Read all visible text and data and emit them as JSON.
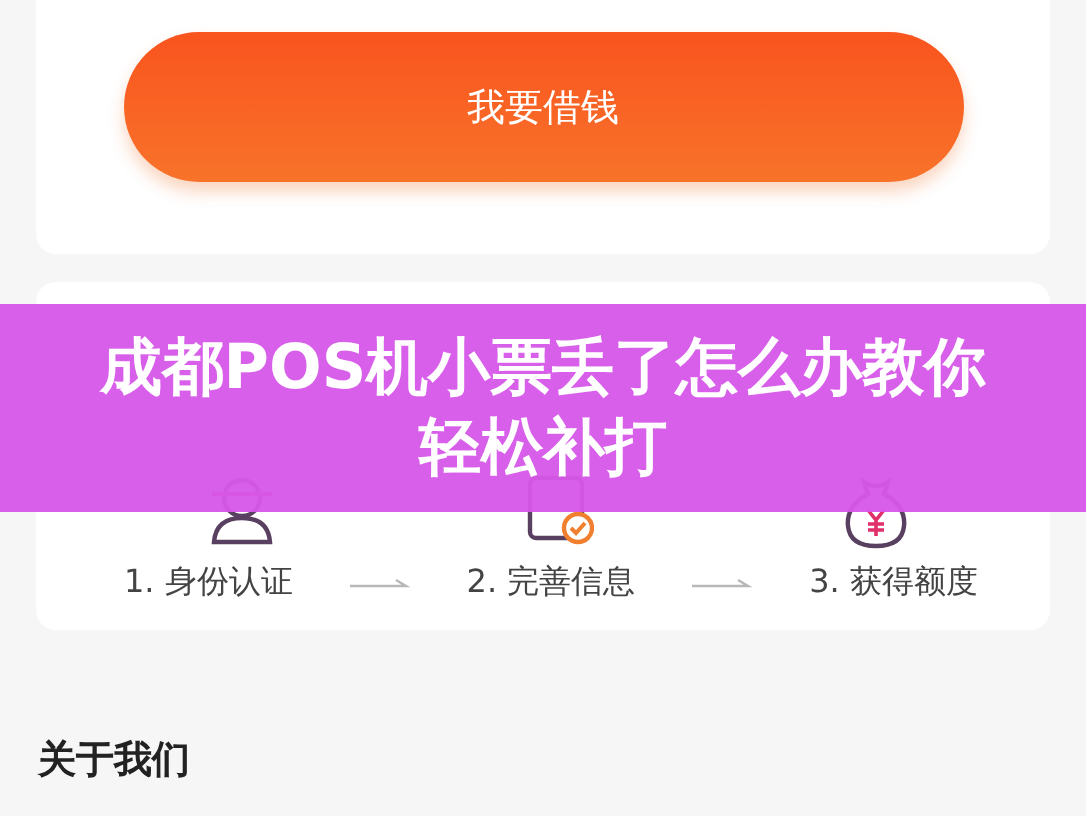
{
  "loan_button": {
    "label": "我要借钱"
  },
  "steps": [
    {
      "label": "1. 身份认证",
      "kind": "identity"
    },
    {
      "label": "2. 完善信息",
      "kind": "info"
    },
    {
      "label": "3. 获得额度",
      "kind": "credit"
    }
  ],
  "about": {
    "title": "关于我们"
  },
  "banner": {
    "title": "成都POS机小票丢了怎么办教你轻松补打"
  }
}
